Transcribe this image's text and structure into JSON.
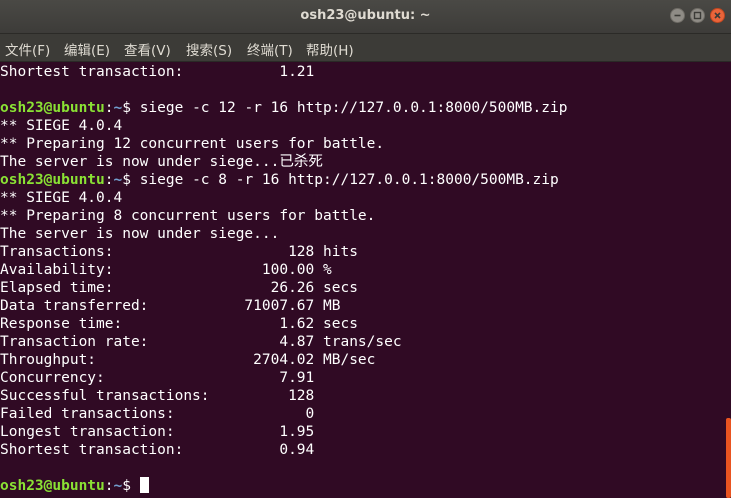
{
  "window": {
    "title": "osh23@ubuntu: ~"
  },
  "menu": {
    "items": [
      "文件(F)",
      "编辑(E)",
      "查看(V)",
      "搜索(S)",
      "终端(T)",
      "帮助(H)"
    ]
  },
  "terminal": {
    "prompt_user": "osh23@ubuntu",
    "prompt_sep": ":",
    "prompt_path": "~",
    "prompt_symbol": "$ ",
    "lines": [
      {
        "type": "text",
        "text": "Shortest transaction:           1.21"
      },
      {
        "type": "text",
        "text": ""
      },
      {
        "type": "prompt",
        "command": "siege -c 12 -r 16 http://127.0.0.1:8000/500MB.zip"
      },
      {
        "type": "text",
        "text": "** SIEGE 4.0.4"
      },
      {
        "type": "text",
        "text": "** Preparing 12 concurrent users for battle."
      },
      {
        "type": "text",
        "text": "The server is now under siege...已杀死"
      },
      {
        "type": "prompt",
        "command": "siege -c 8 -r 16 http://127.0.0.1:8000/500MB.zip"
      },
      {
        "type": "text",
        "text": "** SIEGE 4.0.4"
      },
      {
        "type": "text",
        "text": "** Preparing 8 concurrent users for battle."
      },
      {
        "type": "text",
        "text": "The server is now under siege..."
      },
      {
        "type": "text",
        "text": "Transactions:                    128 hits"
      },
      {
        "type": "text",
        "text": "Availability:                 100.00 %"
      },
      {
        "type": "text",
        "text": "Elapsed time:                  26.26 secs"
      },
      {
        "type": "text",
        "text": "Data transferred:           71007.67 MB"
      },
      {
        "type": "text",
        "text": "Response time:                  1.62 secs"
      },
      {
        "type": "text",
        "text": "Transaction rate:               4.87 trans/sec"
      },
      {
        "type": "text",
        "text": "Throughput:                  2704.02 MB/sec"
      },
      {
        "type": "text",
        "text": "Concurrency:                    7.91"
      },
      {
        "type": "text",
        "text": "Successful transactions:         128"
      },
      {
        "type": "text",
        "text": "Failed transactions:               0"
      },
      {
        "type": "text",
        "text": "Longest transaction:            1.95"
      },
      {
        "type": "text",
        "text": "Shortest transaction:           0.94"
      },
      {
        "type": "text",
        "text": ""
      },
      {
        "type": "prompt",
        "command": "",
        "cursor": true
      }
    ]
  },
  "icons": {
    "minimize": "minimize-icon",
    "maximize": "maximize-icon",
    "close": "close-icon"
  },
  "colors": {
    "terminal_bg": "#300a24",
    "prompt_user": "#8ae234",
    "prompt_path": "#729fcf",
    "scroll_thumb": "#e95420",
    "close_button": "#e9643a"
  }
}
